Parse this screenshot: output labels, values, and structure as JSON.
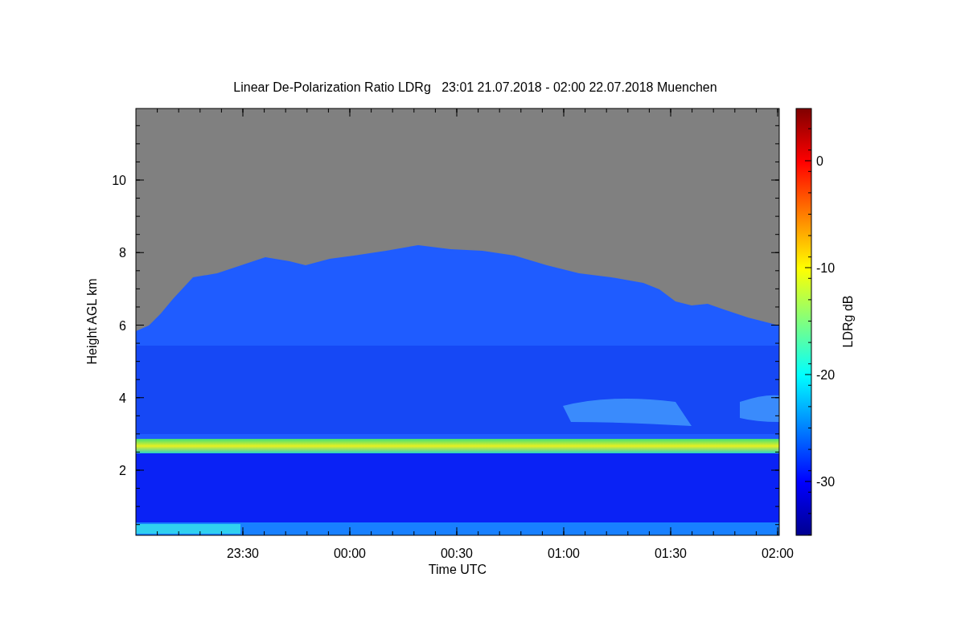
{
  "title": "Linear De-Polarization Ratio LDRg   23:01 21.07.2018 - 02:00 22.07.2018 Muenchen",
  "x_axis": {
    "label": "Time UTC",
    "ticks": [
      "23:30",
      "00:00",
      "00:30",
      "01:00",
      "01:30",
      "02:00"
    ]
  },
  "y_axis": {
    "label": "Height AGL km",
    "ticks": [
      "10",
      "8",
      "6",
      "4",
      "2"
    ]
  },
  "colorbar": {
    "label": "LDRg dB",
    "ticks": [
      "0",
      "-10",
      "-20",
      "-30"
    ]
  }
}
